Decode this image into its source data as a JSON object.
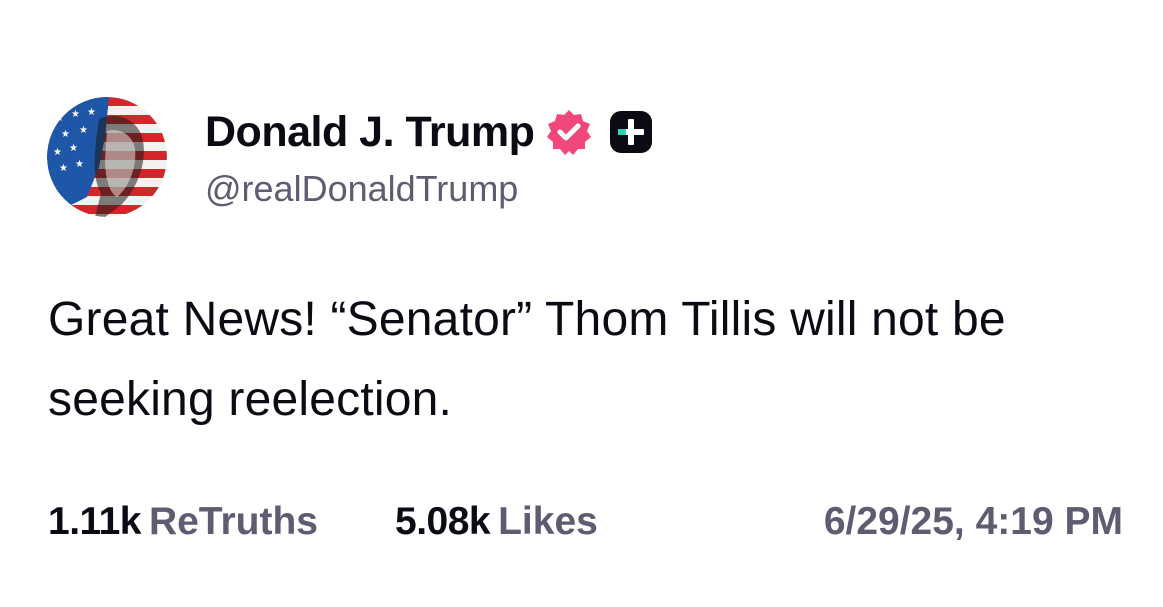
{
  "author": {
    "display_name": "Donald J. Trump",
    "handle": "@realDonaldTrump",
    "verified_icon": "verified-badge-icon",
    "plus_icon": "plus-badge-icon",
    "verified_color": "#f0487a",
    "plus_badge_color": "#0b0b14",
    "plus_accent_color": "#2bd4b0"
  },
  "post": {
    "text": "Great News! “Senator” Thom Tillis will not be seeking reelection."
  },
  "stats": {
    "retruths_count": "1.11k",
    "retruths_label": "ReTruths",
    "likes_count": "5.08k",
    "likes_label": "Likes",
    "timestamp": "6/29/25, 4:19 PM"
  }
}
